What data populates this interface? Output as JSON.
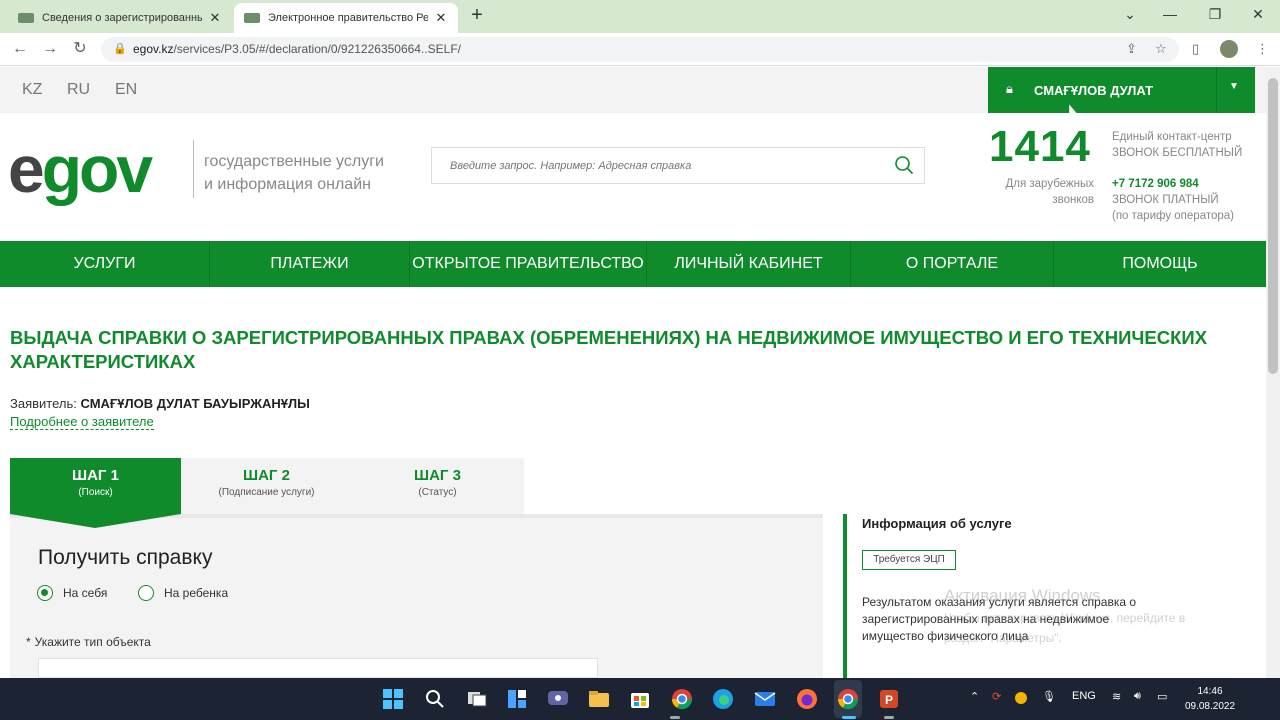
{
  "browser": {
    "tabs": [
      {
        "title": "Сведения о зарегистрированных правах"
      },
      {
        "title": "Электронное правительство Республики Казахстан"
      }
    ],
    "new_tab_label": "+",
    "controls": {
      "chevron": "⌄",
      "minimize": "—",
      "restore": "❐",
      "close": "✕"
    },
    "url_host": "egov.kz",
    "url_path": "/services/P3.05/#/declaration/0/921226350664..SELF/"
  },
  "site": {
    "languages": [
      "KZ",
      "RU",
      "EN"
    ],
    "user_name": "СМАҒҰЛОВ ДУЛАТ",
    "logo_e": "e",
    "logo_gov": "gov",
    "tagline_line1": "государственные услуги",
    "tagline_line2": "и информация онлайн",
    "search_placeholder": "Введите запрос. Например: Адресная справка",
    "hotline_number": "1414",
    "contact_line1": "Единый контакт-центр",
    "contact_line2": "ЗВОНОК БЕСПЛАТНЫЙ",
    "foreign_line1": "Для зарубежных",
    "foreign_line2": "звонков",
    "paid_phone": "+7 7172 906 984",
    "paid_line1": "ЗВОНОК ПЛАТНЫЙ",
    "paid_line2": "(по тарифу оператора)"
  },
  "nav": {
    "items": [
      {
        "label": "УСЛУГИ"
      },
      {
        "label": "ПЛАТЕЖИ"
      },
      {
        "label": "ОТКРЫТОЕ ПРАВИТЕЛЬСТВО"
      },
      {
        "label": "ЛИЧНЫЙ КАБИНЕТ"
      },
      {
        "label": "О ПОРТАЛЕ"
      },
      {
        "label": "ПОМОЩЬ"
      }
    ]
  },
  "page": {
    "title": "ВЫДАЧА СПРАВКИ О ЗАРЕГИСТРИРОВАННЫХ ПРАВАХ (ОБРЕМЕНЕНИЯХ) НА НЕДВИЖИМОЕ ИМУЩЕСТВО И ЕГО ТЕХНИЧЕСКИХ ХАРАКТЕРИСТИКАХ",
    "applicant_label": "Заявитель:",
    "applicant_name": "СМАҒҰЛОВ ДУЛАТ БАУЫРЖАНҰЛЫ",
    "applicant_link": "Подробнее о заявителе"
  },
  "steps": [
    {
      "label": "ШАГ 1",
      "sub": "(Поиск)",
      "active": true
    },
    {
      "label": "ШАГ 2",
      "sub": "(Подписание услуги)",
      "active": false
    },
    {
      "label": "ШАГ 3",
      "sub": "(Статус)",
      "active": false
    }
  ],
  "form": {
    "title": "Получить справку",
    "radio_self": "На себя",
    "radio_child": "На ребенка",
    "selected": "На себя",
    "object_type_label": "Укажите тип объекта",
    "required_mark": "*"
  },
  "info": {
    "title": "Информация об услуге",
    "badge": "Требуется ЭЦП",
    "description": "Результатом оказания услуги является справка о зарегистрированных правах на недвижимое имущество физического лица"
  },
  "watermark": {
    "line1": "Активация Windows",
    "line2": "Чтобы активировать Windows, перейдите в",
    "line3": "раздел \"Параметры\"."
  },
  "taskbar": {
    "lang": "ENG",
    "time": "14:46",
    "date": "09.08.2022"
  },
  "colors": {
    "brand_green": "#0f8b2c",
    "taskbar": "#1c2433",
    "tab_strip": "#d6e8cf"
  }
}
